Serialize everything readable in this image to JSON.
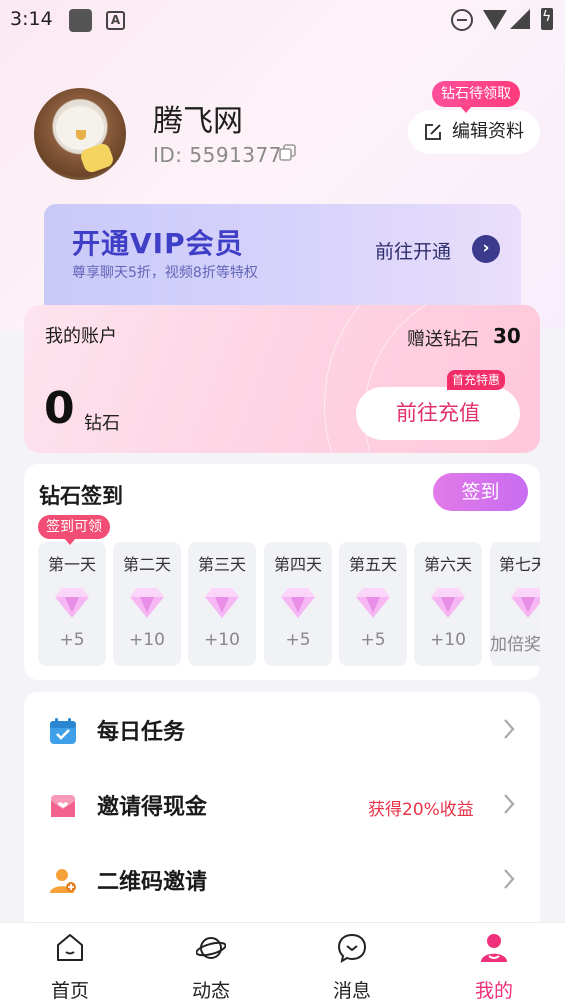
{
  "status_bar": {
    "time": "3:14",
    "icons": [
      "app-icon",
      "a-icon",
      "dnd-icon",
      "wifi-icon",
      "signal-icon",
      "battery-icon"
    ]
  },
  "profile": {
    "name": "腾飞网",
    "id_text": "ID: 5591377",
    "diamond_badge": "钻石待领取",
    "edit_label": "编辑资料"
  },
  "vip": {
    "title": "开通VIP会员",
    "subtitle": "尊享聊天5折，视频8折等特权",
    "go_label": "前往开通"
  },
  "account": {
    "title": "我的账户",
    "gift_label": "赠送钻石",
    "gift_value": "30",
    "balance": "0",
    "balance_unit": "钻石",
    "recharge_label": "前往充值",
    "recharge_tag": "首充特惠"
  },
  "signin": {
    "title": "钻石签到",
    "button_label": "签到",
    "tag": "签到可领",
    "days": [
      {
        "label": "第一天",
        "reward": "+5"
      },
      {
        "label": "第二天",
        "reward": "+10"
      },
      {
        "label": "第三天",
        "reward": "+10"
      },
      {
        "label": "第四天",
        "reward": "+5"
      },
      {
        "label": "第五天",
        "reward": "+5"
      },
      {
        "label": "第六天",
        "reward": "+10"
      },
      {
        "label": "第七天",
        "reward": "加倍奖"
      }
    ]
  },
  "menu": {
    "items": [
      {
        "label": "每日任务",
        "extra": "",
        "icon": "calendar-check-icon"
      },
      {
        "label": "邀请得现金",
        "extra": "获得20%收益",
        "icon": "envelope-heart-icon"
      },
      {
        "label": "二维码邀请",
        "extra": "",
        "icon": "user-invite-icon"
      }
    ]
  },
  "bottom_nav": {
    "items": [
      {
        "label": "首页",
        "icon": "home-icon"
      },
      {
        "label": "动态",
        "icon": "planet-icon"
      },
      {
        "label": "消息",
        "icon": "message-icon"
      },
      {
        "label": "我的",
        "icon": "profile-icon"
      }
    ],
    "active_index": 3
  },
  "colors": {
    "accent_pink": "#f0307a",
    "vip_blue": "#3f3ec7",
    "signin_purple": "#d473ec",
    "income_red": "#e8334a"
  }
}
